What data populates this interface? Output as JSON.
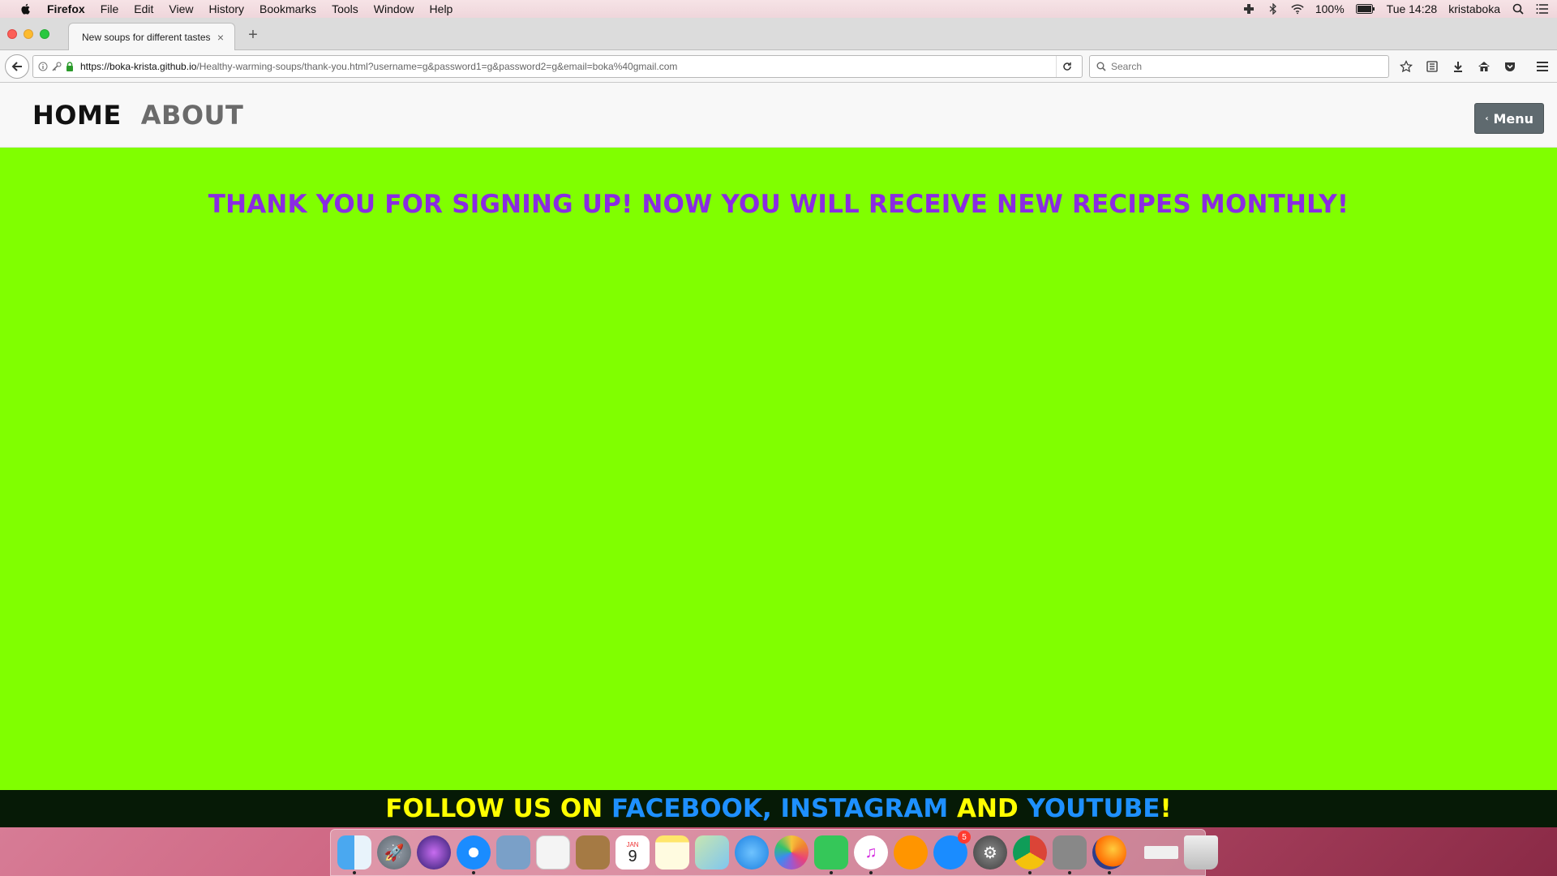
{
  "menubar": {
    "app": "Firefox",
    "items": [
      "File",
      "Edit",
      "View",
      "History",
      "Bookmarks",
      "Tools",
      "Window",
      "Help"
    ],
    "battery": "100%",
    "clock": "Tue 14:28",
    "user": "kristaboka"
  },
  "browser": {
    "tab_title": "New soups for different tastes",
    "url_host": "https://boka-krista.github.io",
    "url_path": "/Healthy-warming-soups/thank-you.html?username=g&password1=g&password2=g&email=boka%40gmail.com",
    "search_placeholder": "Search"
  },
  "page": {
    "nav_home": "HOME",
    "nav_about": "ABOUT",
    "menu_button": "Menu",
    "thanks_message": "THANK YOU FOR SIGNING UP! NOW YOU WILL RECEIVE NEW RECIPES MONTHLY!",
    "footer": {
      "prefix": "FOLLOW US ON ",
      "facebook": "FACEBOOK",
      "comma": ", ",
      "instagram": "INSTAGRAM",
      "and": " AND ",
      "youtube": "YOUTUBE",
      "suffix": "!"
    },
    "colors": {
      "background": "#80ff00",
      "heading": "#8a2be2",
      "footer_bg": "#061a06",
      "footer_text": "#ffff00",
      "footer_link": "#1e90ff"
    }
  },
  "dock": {
    "calendar_day": "9",
    "calendar_month": "JAN",
    "app_store_badge": "5",
    "apps": [
      "finder",
      "launchpad",
      "siri",
      "safari",
      "preview",
      "reminders",
      "notebook",
      "calendar",
      "notes",
      "maps",
      "messages",
      "photos",
      "facetime",
      "itunes",
      "ibooks",
      "app-store",
      "system-preferences",
      "chrome",
      "utility",
      "firefox",
      "downloads",
      "trash"
    ]
  }
}
